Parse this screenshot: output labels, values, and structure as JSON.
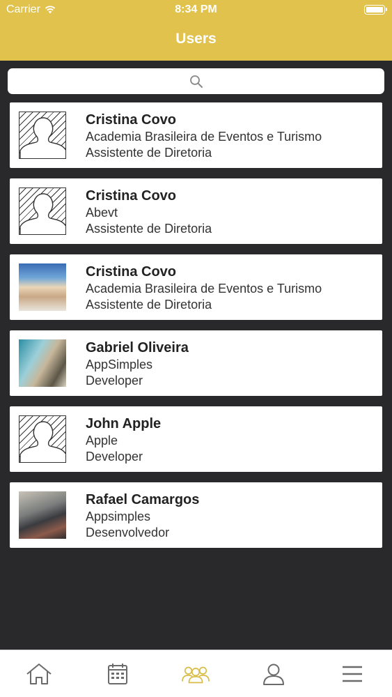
{
  "status_bar": {
    "carrier": "Carrier",
    "time": "8:34 PM"
  },
  "header": {
    "title": "Users"
  },
  "search": {
    "icon": "search-icon"
  },
  "users": [
    {
      "name": "Cristina Covo",
      "company": "Academia Brasileira de Eventos e Turismo",
      "role": "Assistente de Diretoria",
      "avatar": "placeholder"
    },
    {
      "name": "Cristina Covo",
      "company": "Abevt",
      "role": "Assistente de Diretoria",
      "avatar": "placeholder"
    },
    {
      "name": "Cristina Covo",
      "company": "Academia Brasileira de Eventos e Turismo",
      "role": "Assistente de Diretoria",
      "avatar": "photo"
    },
    {
      "name": "Gabriel Oliveira",
      "company": "AppSimples",
      "role": "Developer",
      "avatar": "photo"
    },
    {
      "name": "John Apple",
      "company": "Apple",
      "role": "Developer",
      "avatar": "placeholder"
    },
    {
      "name": "Rafael Camargos",
      "company": "Appsimples",
      "role": "Desenvolvedor",
      "avatar": "photo"
    }
  ],
  "tab_bar": {
    "tabs": [
      {
        "icon": "home-icon",
        "active": false
      },
      {
        "icon": "calendar-icon",
        "active": false
      },
      {
        "icon": "users-icon",
        "active": true
      },
      {
        "icon": "profile-icon",
        "active": false
      },
      {
        "icon": "menu-icon",
        "active": false
      }
    ]
  },
  "colors": {
    "accent": "#e0c24c",
    "background": "#29282a",
    "tab_icon": "#6b6b6b"
  }
}
